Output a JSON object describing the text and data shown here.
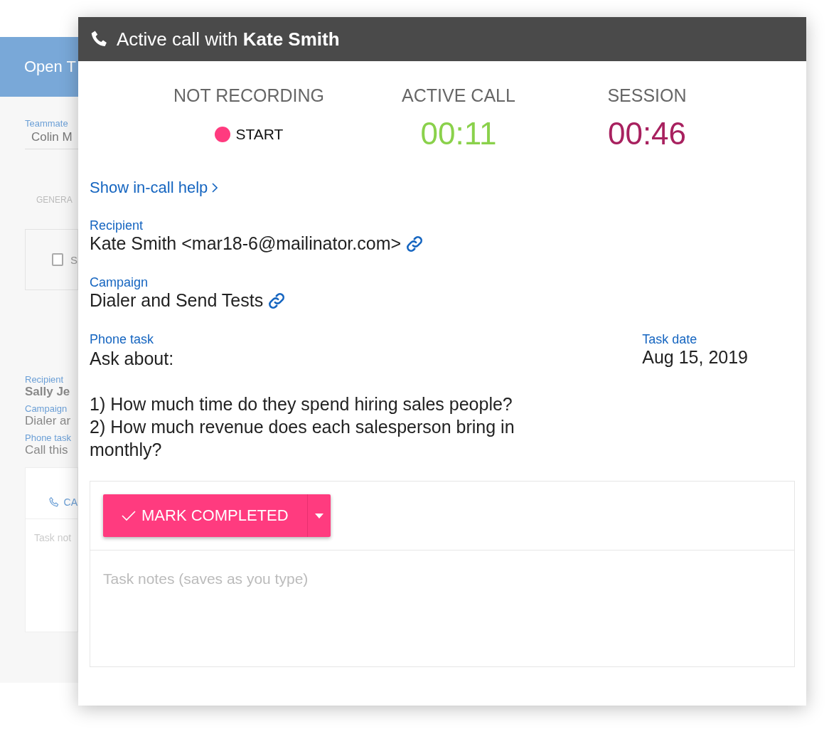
{
  "background_window": {
    "header": "Open T",
    "teammate": {
      "label": "Teammate",
      "value": "Colin M"
    },
    "stat": {
      "label": "GENERA"
    },
    "checkbox": {
      "label": "S",
      "checked": false
    },
    "fields": [
      {
        "label": "Recipient",
        "value": "Sally Je",
        "bold": true
      },
      {
        "label": "Campaign",
        "value": "Dialer ar",
        "bold": false
      },
      {
        "label": "Phone task",
        "value": "Call this",
        "bold": false
      }
    ],
    "call_button": "CA",
    "notes_placeholder": "Task not"
  },
  "call_window": {
    "title": "Active call with **Kate Smith**",
    "stats": [
      {
        "kind": "recording",
        "label": "NOT RECORDING",
        "action": "START"
      },
      {
        "kind": "timer",
        "label": "ACTIVE CALL",
        "value": "00:11",
        "color": "#8ad14b"
      },
      {
        "kind": "timer",
        "label": "SESSION",
        "value": "00:46",
        "color": "#a8215f"
      }
    ],
    "help_link": "Show in-call help",
    "recipient": {
      "label": "Recipient",
      "value": "Kate Smith <mar18-6@mailinator.com>"
    },
    "campaign": {
      "label": "Campaign",
      "value": "Dialer and Send Tests"
    },
    "phone_task": {
      "label": "Phone task",
      "heading": "Ask about:",
      "lines": [
        "1) How much time do they spend hiring sales people?",
        "2) How much revenue does each salesperson bring in monthly?"
      ]
    },
    "task_date": {
      "label": "Task date",
      "value": "Aug 15, 2019"
    },
    "complete_button": "MARK COMPLETED",
    "notes_placeholder": "Task notes (saves as you type)"
  }
}
